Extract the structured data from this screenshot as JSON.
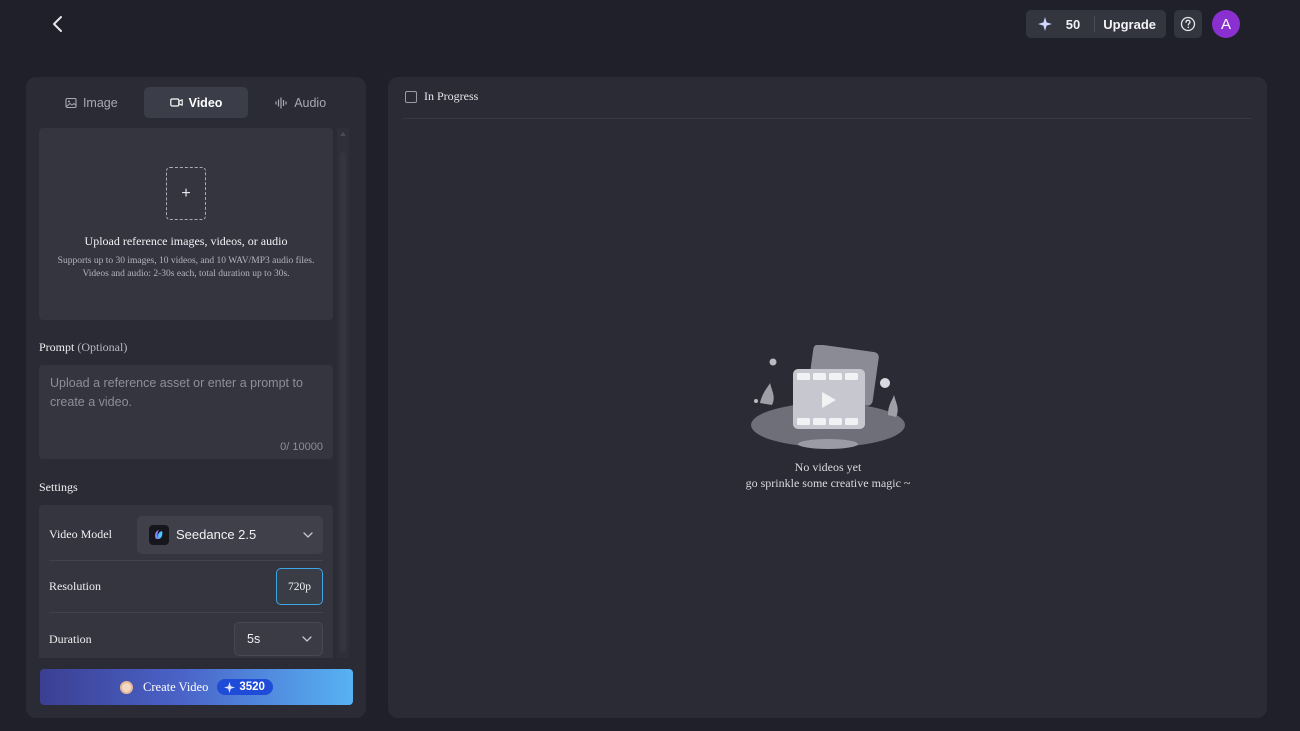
{
  "header": {
    "credits": "50",
    "upgrade_label": "Upgrade",
    "avatar_initial": "A",
    "accent": "#8a2fd0"
  },
  "tabs": [
    {
      "label": "Image",
      "icon": "image-icon",
      "active": false
    },
    {
      "label": "Video",
      "icon": "video-icon",
      "active": true
    },
    {
      "label": "Audio",
      "icon": "audio-wave-icon",
      "active": false
    }
  ],
  "upload": {
    "title": "Upload reference images, videos, or audio",
    "description": "Supports up to 30 images, 10 videos, and 10 WAV/MP3 audio files. Videos and audio: 2-30s each, total duration up to 30s."
  },
  "prompt": {
    "label": "Prompt",
    "optional": "(Optional)",
    "placeholder": "Upload a reference asset or enter a prompt to create a video.",
    "value": "",
    "counter": "0/ 10000"
  },
  "settings": {
    "label": "Settings",
    "video_model_label": "Video Model",
    "video_model_value": "Seedance 2.5",
    "resolution_label": "Resolution",
    "resolution_value": "720p",
    "duration_label": "Duration",
    "duration_value": "5s"
  },
  "create": {
    "label": "Create Video",
    "cost": "3520"
  },
  "results": {
    "in_progress_label": "In Progress",
    "empty_title": "No videos yet",
    "empty_subtitle": "go sprinkle some creative magic ~"
  }
}
